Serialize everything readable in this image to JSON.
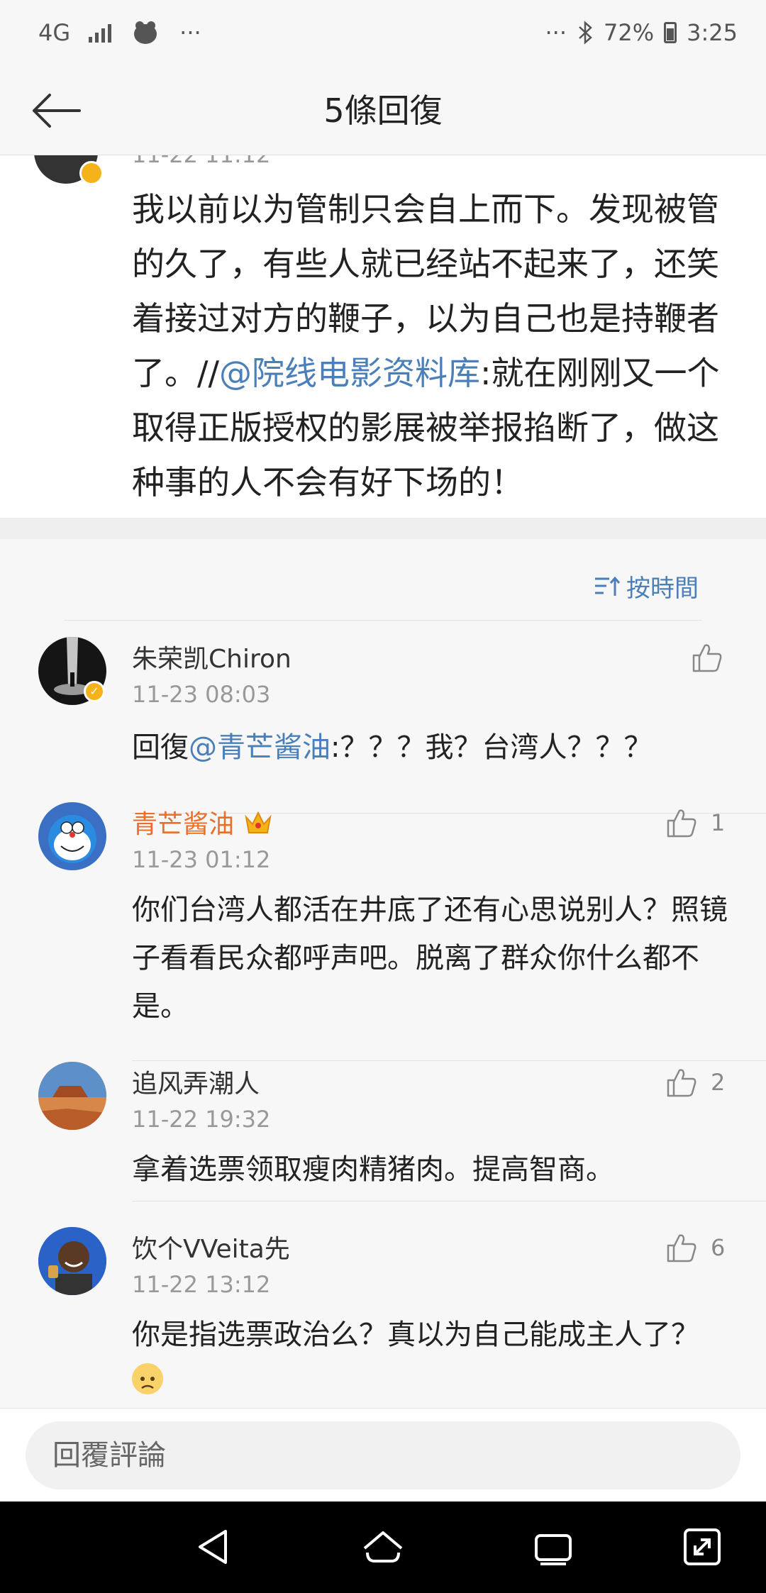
{
  "status_bar": {
    "network": "4G",
    "dots_left": "···",
    "dots_right": "···",
    "battery": "72%",
    "time": "3:25"
  },
  "header": {
    "title": "5條回復"
  },
  "original_post": {
    "time": "11-22 11:12",
    "text_before": "我以前以为管制只会自上而下。发现被管的久了，有些人就已经站不起来了，还笑着接过对方的鞭子，以为自己也是持鞭者了。//",
    "mention": "@院线电影资料库",
    "text_after": ":就在刚刚又一个取得正版授权的影展被举报掐断了，做这种事的人不会有好下场的！"
  },
  "sort": {
    "label": "按時間"
  },
  "comments": [
    {
      "name": "朱荣凯Chiron",
      "time": "11-23 08:03",
      "prefix": "回復",
      "mention": "@青芒酱油",
      "text": ":？？？我？台湾人？？？",
      "likes": ""
    },
    {
      "name": "青芒酱油",
      "time": "11-23 01:12",
      "text": "你们台湾人都活在井底了还有心思说别人？照镜子看看民众都呼声吧。脱离了群众你什么都不是。",
      "likes": "1"
    },
    {
      "name": "追风弄潮人",
      "time": "11-22 19:32",
      "text": "拿着选票领取瘦肉精猪肉。提高智商。",
      "likes": "2"
    },
    {
      "name": "饮个VVeita先",
      "time": "11-22 13:12",
      "text": "你是指选票政治么？真以为自己能成主人了？",
      "likes": "6"
    }
  ],
  "reply_bar": {
    "placeholder": "回覆評論"
  },
  "colors": {
    "link": "#4a7fb8",
    "vip_name": "#e8702a",
    "badge": "#f5b21a"
  }
}
